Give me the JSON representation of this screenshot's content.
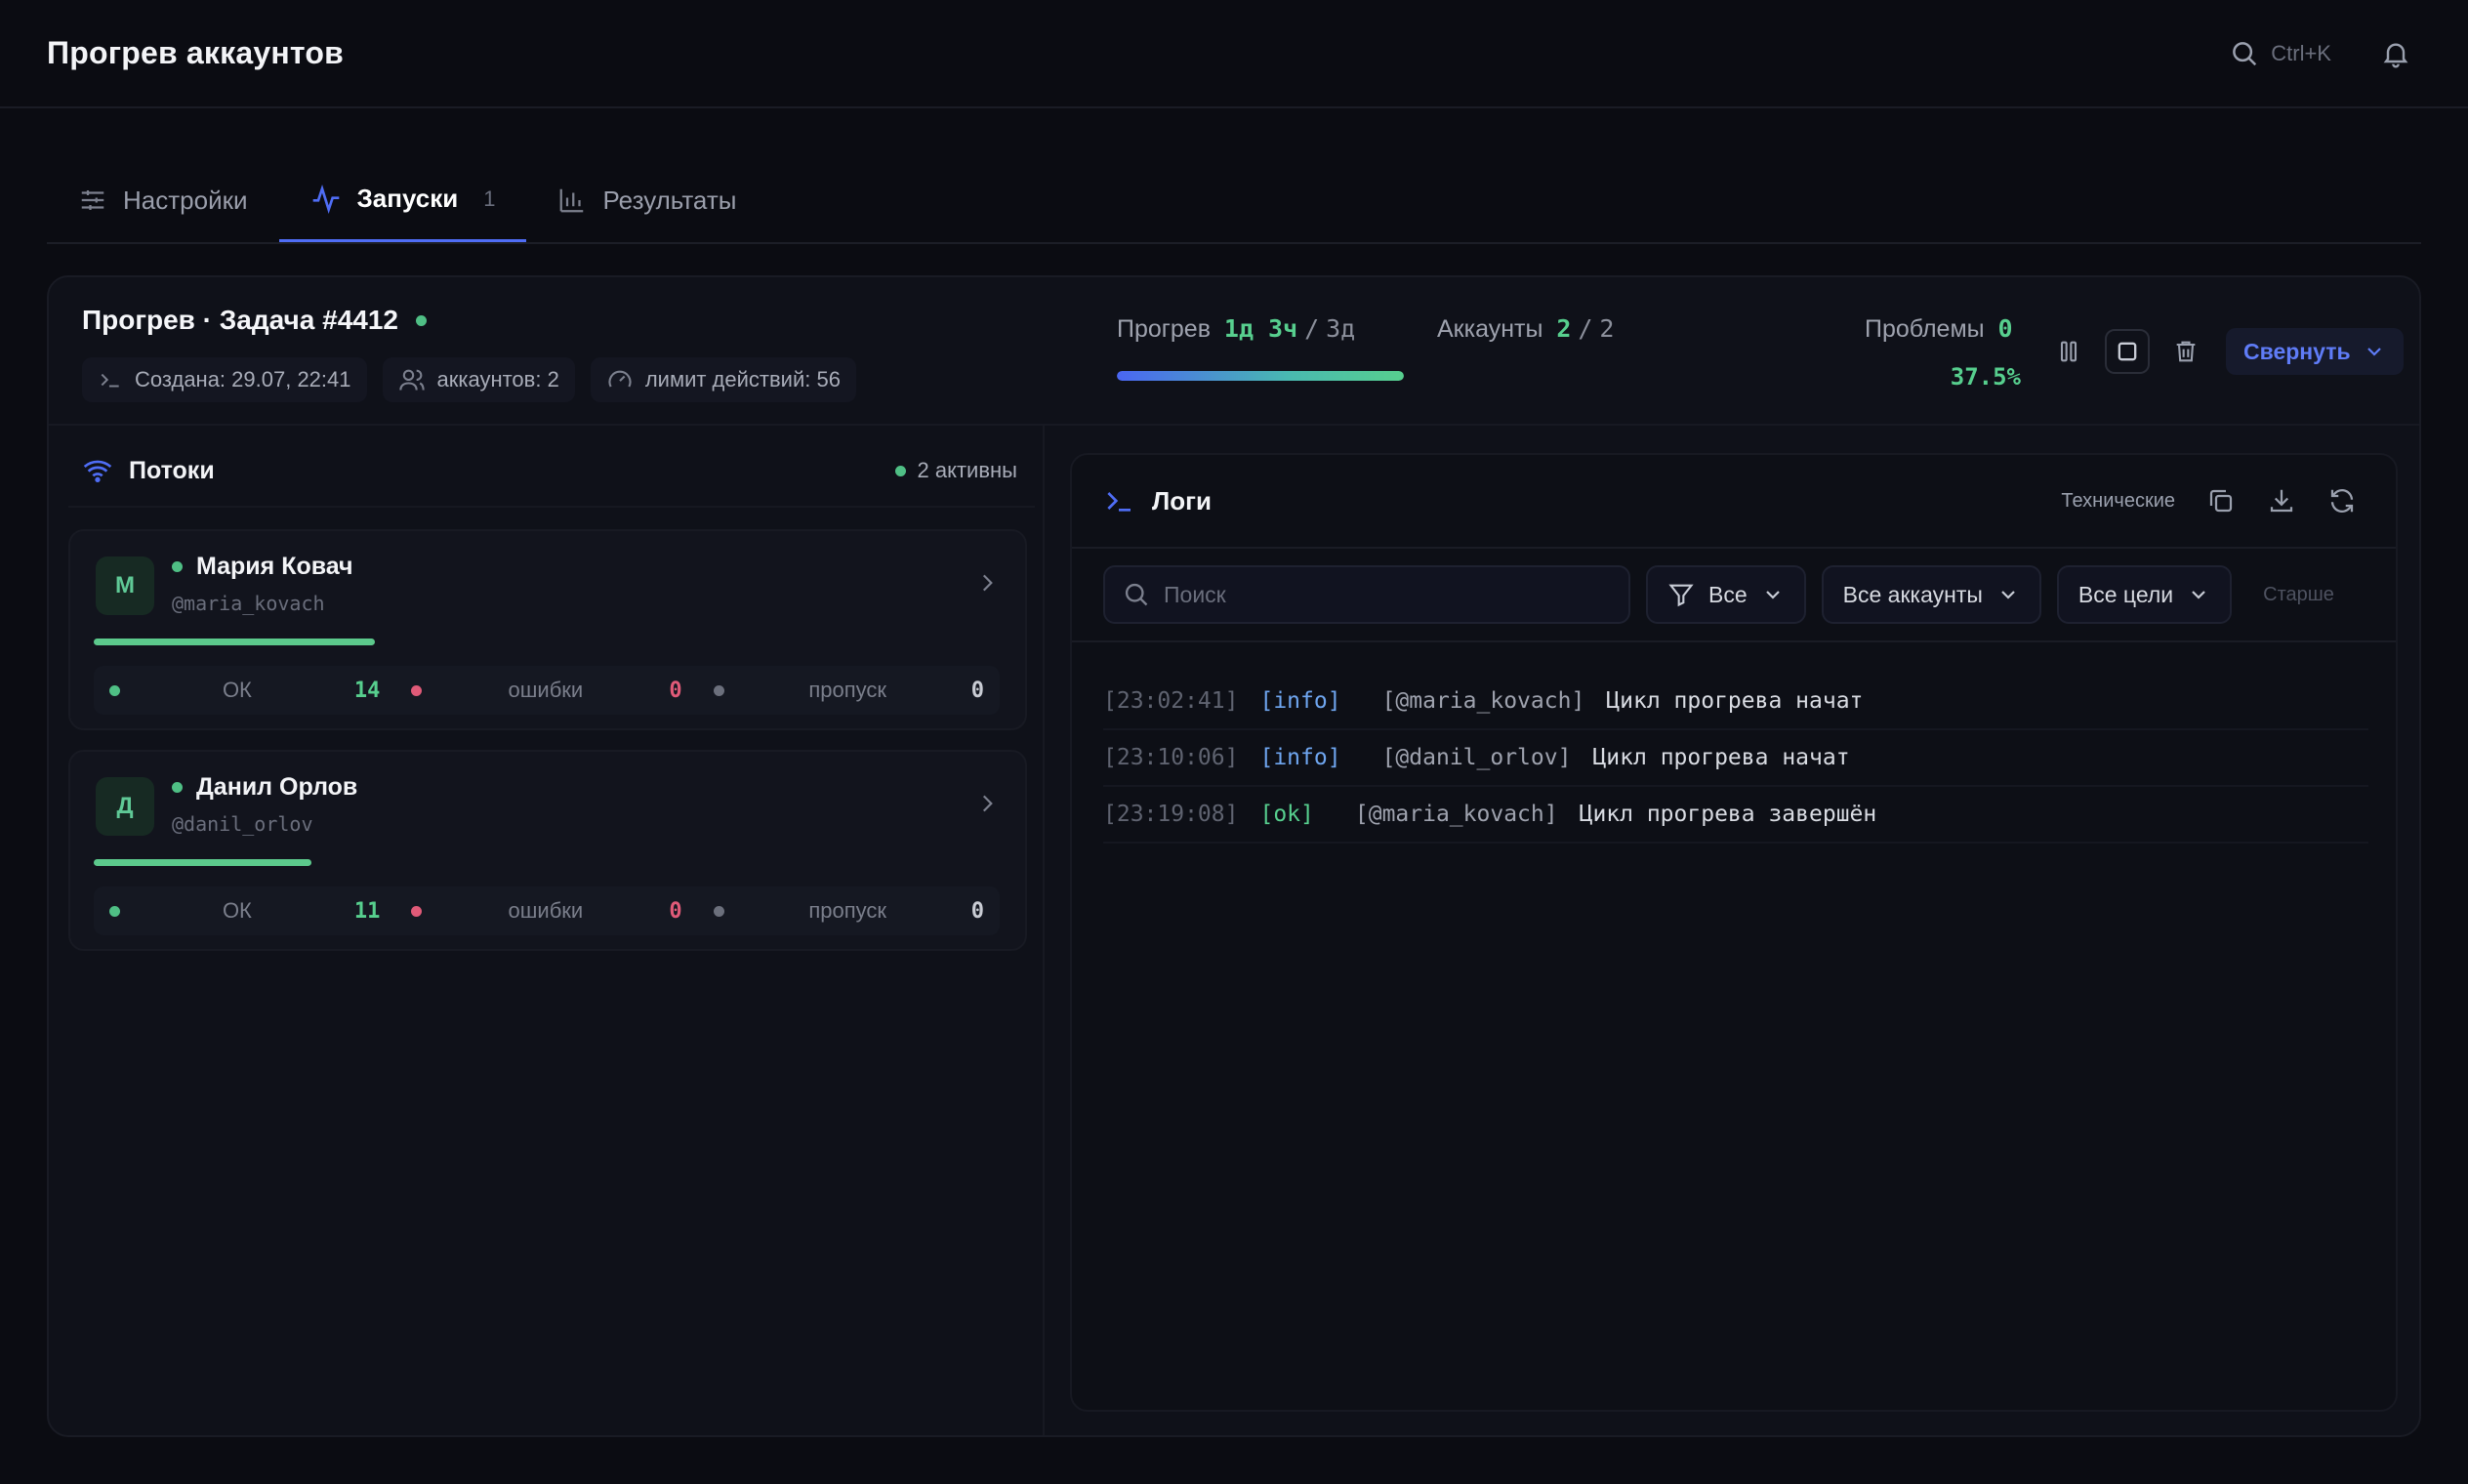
{
  "header": {
    "title": "Прогрев аккаунтов",
    "search_hint": "Ctrl+K"
  },
  "tabs": [
    {
      "label": "Настройки"
    },
    {
      "label": "Запуски",
      "count": "1"
    },
    {
      "label": "Результаты"
    }
  ],
  "run": {
    "title": "Прогрев · Задача #4412",
    "created": "Создана: 29.07, 22:41",
    "accounts_chip": "аккаунтов: 2",
    "limit_chip": "лимит действий: 56",
    "progress_label": "Прогрев",
    "progress_value": "1д 3ч",
    "progress_total": "3д",
    "accounts_label": "Аккаунты",
    "accounts_value": "2",
    "accounts_total": "2",
    "problems_label": "Проблемы",
    "problems_value": "0",
    "percent": "37.5%",
    "progress_fraction": 0.375,
    "collapse_label": "Свернуть",
    "slash": "/"
  },
  "streams": {
    "title": "Потоки",
    "active": "2 активны",
    "accounts": [
      {
        "initial": "М",
        "name": "Мария Ковач",
        "handle": "@maria_kovach",
        "progress_fraction": 0.31,
        "ok_label": "ОК",
        "ok": "14",
        "err_label": "ошибки",
        "err": "0",
        "skip_label": "пропуск",
        "skip": "0"
      },
      {
        "initial": "Д",
        "name": "Данил Орлов",
        "handle": "@danil_orlov",
        "progress_fraction": 0.24,
        "ok_label": "ОК",
        "ok": "11",
        "err_label": "ошибки",
        "err": "0",
        "skip_label": "пропуск",
        "skip": "0"
      }
    ]
  },
  "logs": {
    "title": "Логи",
    "technical": "Технические",
    "search_placeholder": "Поиск",
    "filter_level": "Все",
    "filter_accounts": "Все аккаунты",
    "filter_targets": "Все цели",
    "older": "Старше",
    "rows": [
      {
        "time": "[23:02:41]",
        "level": "[info]",
        "level_type": "info",
        "user": "[@maria_kovach]",
        "msg": "Цикл прогрева начат"
      },
      {
        "time": "[23:10:06]",
        "level": "[info]",
        "level_type": "info",
        "user": "[@danil_orlov]",
        "msg": "Цикл прогрева начат"
      },
      {
        "time": "[23:19:08]",
        "level": "[ok]",
        "level_type": "ok",
        "user": "[@maria_kovach]",
        "msg": "Цикл прогрева завершён"
      }
    ]
  },
  "colors": {
    "accent": "#4f6df5",
    "success": "#57cf8e",
    "error": "#e05a78",
    "background": "#0b0c12"
  }
}
